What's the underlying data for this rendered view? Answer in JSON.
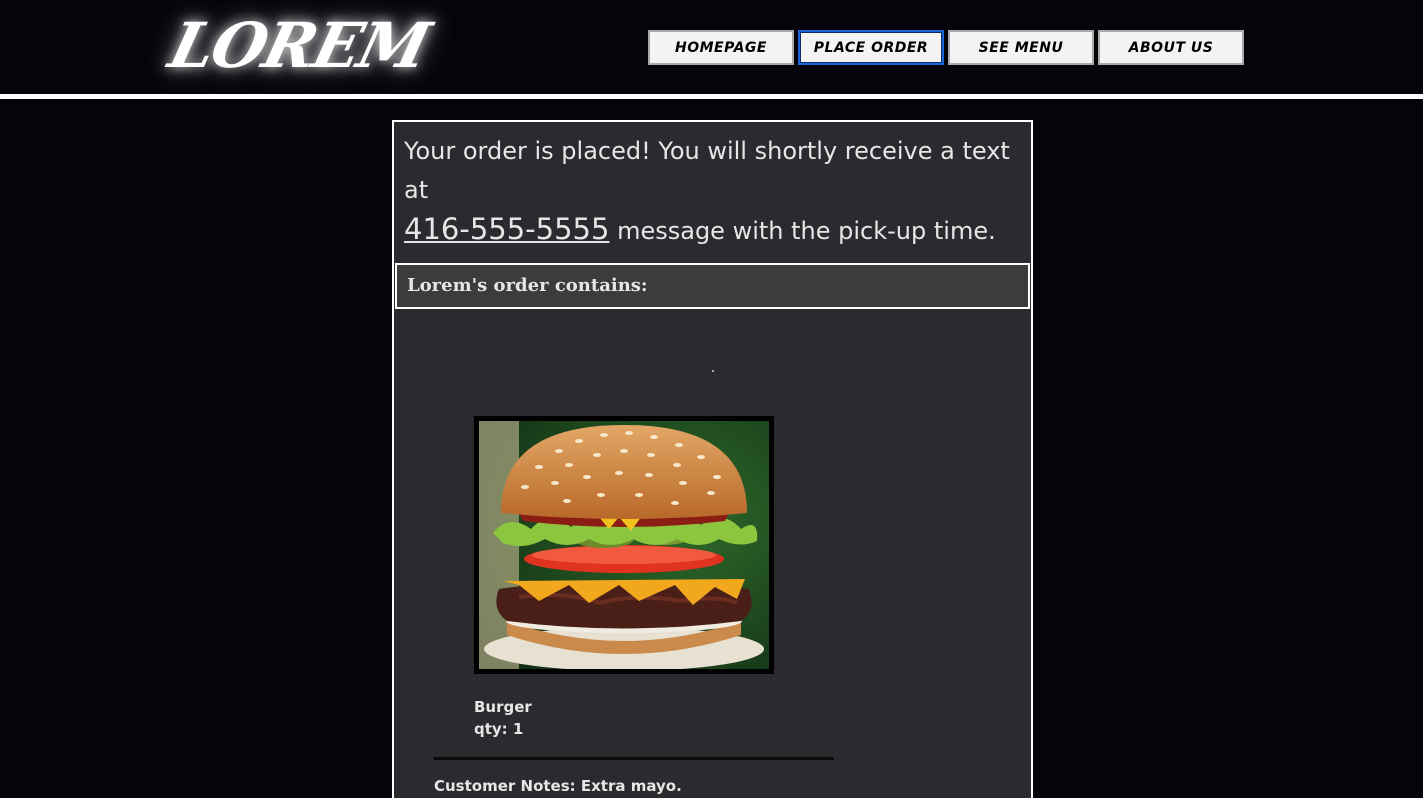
{
  "header": {
    "logo": "LOREM",
    "nav": [
      {
        "label": "HOMEPAGE",
        "active": false
      },
      {
        "label": "PLACE ORDER",
        "active": true
      },
      {
        "label": "SEE MENU",
        "active": false
      },
      {
        "label": "ABOUT US",
        "active": false
      }
    ]
  },
  "confirmation": {
    "text_before": "Your order is placed! You will shortly receive a text at",
    "phone": "416-555-5555",
    "text_after": "message with the pick-up time."
  },
  "order": {
    "heading": "Lorem's order contains:",
    "items": [
      {
        "name": "Burger",
        "qty": "qty: 1",
        "image": "burger-photo"
      }
    ],
    "notes": "Customer Notes: Extra mayo."
  },
  "colors": {
    "background": "#05040a",
    "card": "#2b2a2f",
    "heading_bar": "#3c3c3f",
    "active_border": "#1a66d9"
  }
}
